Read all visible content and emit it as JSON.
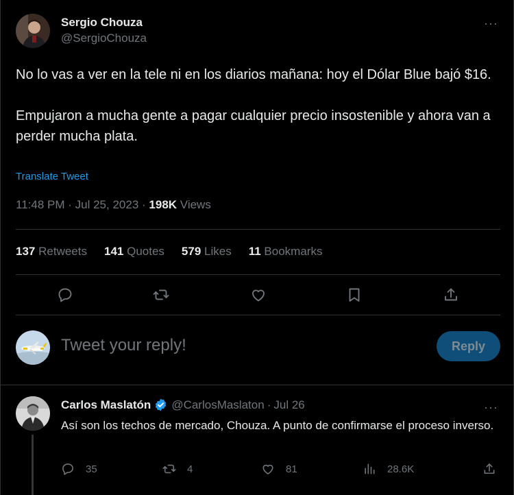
{
  "tweet": {
    "author": {
      "display_name": "Sergio Chouza",
      "handle": "@SergioChouza"
    },
    "more_label": "···",
    "paragraphs": [
      "No lo vas a ver en la tele ni en los diarios mañana: hoy el Dólar Blue bajó $16.",
      "Empujaron a mucha gente a pagar cualquier precio insostenible y ahora van a perder mucha plata."
    ],
    "translate_label": "Translate Tweet",
    "time": "11:48 PM",
    "date": "Jul 25, 2023",
    "views_count": "198K",
    "views_label": "Views",
    "stats": [
      {
        "count": "137",
        "label": "Retweets"
      },
      {
        "count": "141",
        "label": "Quotes"
      },
      {
        "count": "579",
        "label": "Likes"
      },
      {
        "count": "11",
        "label": "Bookmarks"
      }
    ],
    "actions": [
      "reply-icon",
      "retweet-icon",
      "like-icon",
      "bookmark-icon",
      "share-icon"
    ]
  },
  "compose": {
    "placeholder": "Tweet your reply!",
    "button_label": "Reply",
    "button_color": "#0f4e78"
  },
  "reply": {
    "display_name": "Carlos Maslatón",
    "handle": "@CarlosMaslaton",
    "separator": "·",
    "date": "Jul 26",
    "more_label": "···",
    "text": "Así son los techos de mercado, Chouza. A punto de confirmarse el proceso inverso.",
    "replies": "35",
    "retweets": "4",
    "likes": "81",
    "views": "28.6K"
  },
  "colors": {
    "background": "#000000",
    "text": "#e7e9ea",
    "muted": "#71767b",
    "link": "#1d9bf0",
    "divider": "#2f3336",
    "verified": "#1d9bf0"
  }
}
